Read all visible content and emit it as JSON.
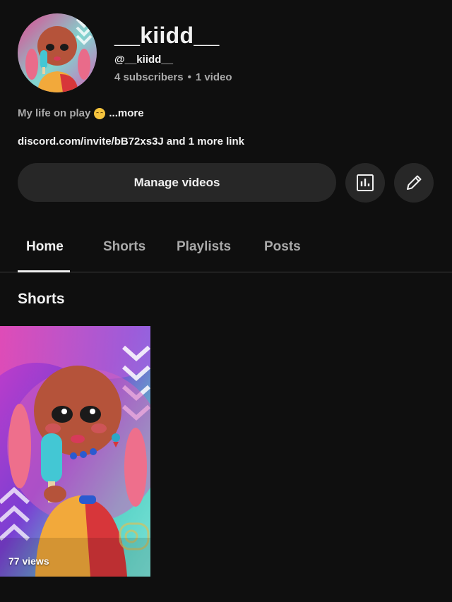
{
  "channel": {
    "name": "__kiidd__",
    "handle": "@__kiidd__",
    "subscribers": "4 subscribers",
    "separator": "•",
    "videos": "1 video",
    "description": "My life on play",
    "description_emoji": "smiling-face-emoji",
    "more_label": "...more",
    "links_text": "discord.com/invite/bB72xs3J and 1 more link"
  },
  "actions": {
    "manage_videos": "Manage videos",
    "analytics_icon": "analytics-bar-chart-icon",
    "edit_icon": "pencil-edit-icon"
  },
  "tabs": [
    {
      "label": "Home",
      "active": true
    },
    {
      "label": "Shorts",
      "active": false
    },
    {
      "label": "Playlists",
      "active": false
    },
    {
      "label": "Posts",
      "active": false
    }
  ],
  "shorts_section": {
    "title": "Shorts",
    "items": [
      {
        "views": "77 views"
      }
    ]
  },
  "colors": {
    "background": "#0f0f0f",
    "button": "#272727",
    "text_primary": "#f1f1f1",
    "text_secondary": "#aaaaaa"
  }
}
